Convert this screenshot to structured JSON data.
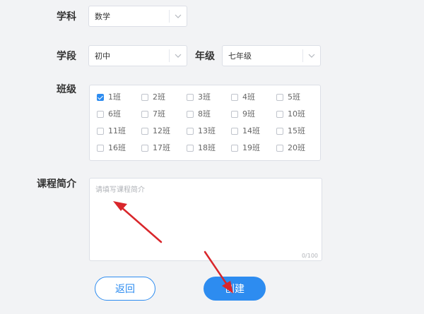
{
  "subject": {
    "label": "学科",
    "value": "数学"
  },
  "stage": {
    "label": "学段",
    "value": "初中"
  },
  "grade": {
    "label": "年级",
    "value": "七年级"
  },
  "classes": {
    "label": "班级",
    "items": [
      {
        "label": "1班",
        "checked": true
      },
      {
        "label": "2班",
        "checked": false
      },
      {
        "label": "3班",
        "checked": false
      },
      {
        "label": "4班",
        "checked": false
      },
      {
        "label": "5班",
        "checked": false
      },
      {
        "label": "6班",
        "checked": false
      },
      {
        "label": "7班",
        "checked": false
      },
      {
        "label": "8班",
        "checked": false
      },
      {
        "label": "9班",
        "checked": false
      },
      {
        "label": "10班",
        "checked": false
      },
      {
        "label": "11班",
        "checked": false
      },
      {
        "label": "12班",
        "checked": false
      },
      {
        "label": "13班",
        "checked": false
      },
      {
        "label": "14班",
        "checked": false
      },
      {
        "label": "15班",
        "checked": false
      },
      {
        "label": "16班",
        "checked": false
      },
      {
        "label": "17班",
        "checked": false
      },
      {
        "label": "18班",
        "checked": false
      },
      {
        "label": "19班",
        "checked": false
      },
      {
        "label": "20班",
        "checked": false
      }
    ]
  },
  "intro": {
    "label": "课程简介",
    "placeholder": "请填写课程简介",
    "value": "",
    "counter": "0/100"
  },
  "buttons": {
    "back": "返回",
    "create": "创建"
  },
  "colors": {
    "accent": "#2d8cf0",
    "arrow": "#d9262b"
  }
}
